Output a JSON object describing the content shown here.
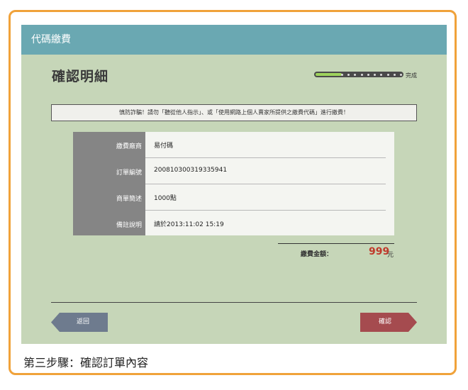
{
  "window": {
    "title": "代碼繳費"
  },
  "page": {
    "heading": "確認明細"
  },
  "progress": {
    "label": "完成",
    "fraction": 0.3
  },
  "notice": "慎防詐騙！請勿「聽從他人指示」、或「使用網路上個人賣家所提供之繳費代碼」進行繳費！",
  "details": [
    {
      "label": "繳費廠商",
      "value": "易付碼"
    },
    {
      "label": "訂單編號",
      "value": "200810300319335941"
    },
    {
      "label": "商單簡述",
      "value": "1000點"
    },
    {
      "label": "備註說明",
      "value": "請於2013:11:02 15:19"
    }
  ],
  "total": {
    "label": "繳費金額：",
    "amount": "999",
    "unit": "元"
  },
  "buttons": {
    "back": "返回",
    "confirm": "確認"
  },
  "caption": "第三步驟：確認訂單內容",
  "colors": {
    "accent": "#6aa8b2",
    "amount": "#c0392b",
    "frame": "#f0a23a"
  }
}
